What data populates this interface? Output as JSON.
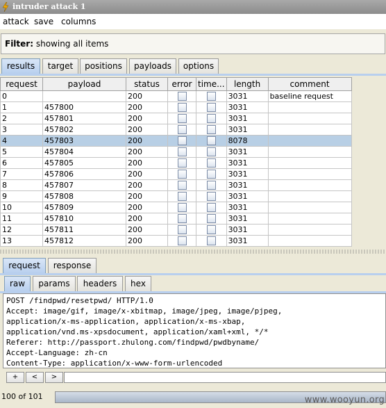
{
  "window": {
    "title": "intruder attack 1"
  },
  "menu": [
    "attack",
    "save",
    "columns"
  ],
  "filter": {
    "label": "Filter:",
    "value": "showing all items"
  },
  "main_tabs": [
    "results",
    "target",
    "positions",
    "payloads",
    "options"
  ],
  "table": {
    "columns": [
      "request",
      "payload",
      "status",
      "error",
      "time...",
      "length",
      "comment"
    ],
    "rows": [
      {
        "request": "0",
        "payload": "",
        "status": "200",
        "length": "3031",
        "comment": "baseline request"
      },
      {
        "request": "1",
        "payload": "457800",
        "status": "200",
        "length": "3031",
        "comment": ""
      },
      {
        "request": "2",
        "payload": "457801",
        "status": "200",
        "length": "3031",
        "comment": ""
      },
      {
        "request": "3",
        "payload": "457802",
        "status": "200",
        "length": "3031",
        "comment": ""
      },
      {
        "request": "4",
        "payload": "457803",
        "status": "200",
        "length": "8078",
        "comment": "",
        "selected": true
      },
      {
        "request": "5",
        "payload": "457804",
        "status": "200",
        "length": "3031",
        "comment": ""
      },
      {
        "request": "6",
        "payload": "457805",
        "status": "200",
        "length": "3031",
        "comment": ""
      },
      {
        "request": "7",
        "payload": "457806",
        "status": "200",
        "length": "3031",
        "comment": ""
      },
      {
        "request": "8",
        "payload": "457807",
        "status": "200",
        "length": "3031",
        "comment": ""
      },
      {
        "request": "9",
        "payload": "457808",
        "status": "200",
        "length": "3031",
        "comment": ""
      },
      {
        "request": "10",
        "payload": "457809",
        "status": "200",
        "length": "3031",
        "comment": ""
      },
      {
        "request": "11",
        "payload": "457810",
        "status": "200",
        "length": "3031",
        "comment": ""
      },
      {
        "request": "12",
        "payload": "457811",
        "status": "200",
        "length": "3031",
        "comment": ""
      },
      {
        "request": "13",
        "payload": "457812",
        "status": "200",
        "length": "3031",
        "comment": ""
      }
    ]
  },
  "detail_tabs": [
    "request",
    "response"
  ],
  "view_tabs": [
    "raw",
    "params",
    "headers",
    "hex"
  ],
  "request_text": [
    "POST /findpwd/resetpwd/ HTTP/1.0",
    "Accept: image/gif, image/x-xbitmap, image/jpeg, image/pjpeg,",
    "application/x-ms-application, application/x-ms-xbap,",
    "application/vnd.ms-xpsdocument, application/xaml+xml, */*",
    "Referer: http://passport.zhulong.com/findpwd/pwdbyname/",
    "Accept-Language: zh-cn",
    "Content-Type: application/x-www-form-urlencoded"
  ],
  "nav_buttons": [
    "+",
    "<",
    ">"
  ],
  "status": {
    "count": "100 of 101",
    "progress": 1.0
  },
  "watermark": "www.wooyun.org",
  "colors": {
    "selected_row": "#b8cfe5",
    "active_tab": "#b8cfee",
    "titlebar": "#8c8c8c"
  }
}
